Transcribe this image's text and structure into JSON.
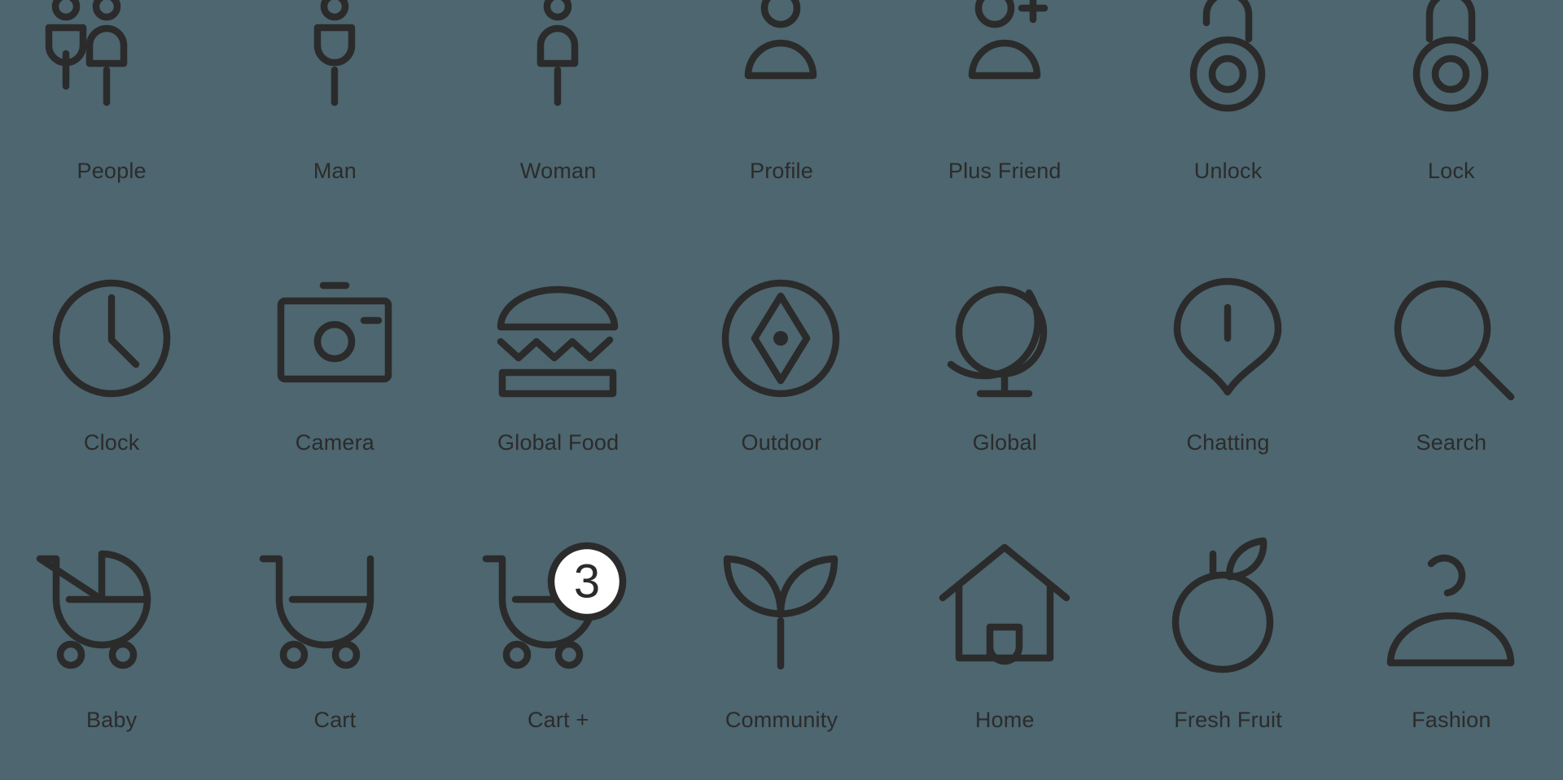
{
  "page": {
    "background_color": "#4d666f",
    "icon_color": "#2b2b2b",
    "badge_fill_color": "#ffffff",
    "columns": 7,
    "rows": 3
  },
  "icons": [
    {
      "id": "people",
      "label": "People",
      "icon_name": "people-icon"
    },
    {
      "id": "man",
      "label": "Man",
      "icon_name": "man-icon"
    },
    {
      "id": "woman",
      "label": "Woman",
      "icon_name": "woman-icon"
    },
    {
      "id": "profile",
      "label": "Profile",
      "icon_name": "profile-icon"
    },
    {
      "id": "plus-friend",
      "label": "Plus Friend",
      "icon_name": "plus-friend-icon"
    },
    {
      "id": "unlock",
      "label": "Unlock",
      "icon_name": "unlock-icon"
    },
    {
      "id": "lock",
      "label": "Lock",
      "icon_name": "lock-icon"
    },
    {
      "id": "clock",
      "label": "Clock",
      "icon_name": "clock-icon"
    },
    {
      "id": "camera",
      "label": "Camera",
      "icon_name": "camera-icon"
    },
    {
      "id": "global-food",
      "label": "Global Food",
      "icon_name": "global-food-icon"
    },
    {
      "id": "outdoor",
      "label": "Outdoor",
      "icon_name": "outdoor-compass-icon"
    },
    {
      "id": "global",
      "label": "Global",
      "icon_name": "globe-icon"
    },
    {
      "id": "chatting",
      "label": "Chatting",
      "icon_name": "chatting-icon"
    },
    {
      "id": "search",
      "label": "Search",
      "icon_name": "search-icon"
    },
    {
      "id": "baby",
      "label": "Baby",
      "icon_name": "baby-stroller-icon"
    },
    {
      "id": "cart",
      "label": "Cart",
      "icon_name": "cart-icon"
    },
    {
      "id": "cart-plus",
      "label": "Cart +",
      "icon_name": "cart-plus-icon",
      "badge": "3"
    },
    {
      "id": "community",
      "label": "Community",
      "icon_name": "community-sprout-icon"
    },
    {
      "id": "home",
      "label": "Home",
      "icon_name": "home-icon"
    },
    {
      "id": "fresh-fruit",
      "label": "Fresh Fruit",
      "icon_name": "fresh-fruit-icon"
    },
    {
      "id": "fashion",
      "label": "Fashion",
      "icon_name": "fashion-hanger-icon"
    }
  ]
}
